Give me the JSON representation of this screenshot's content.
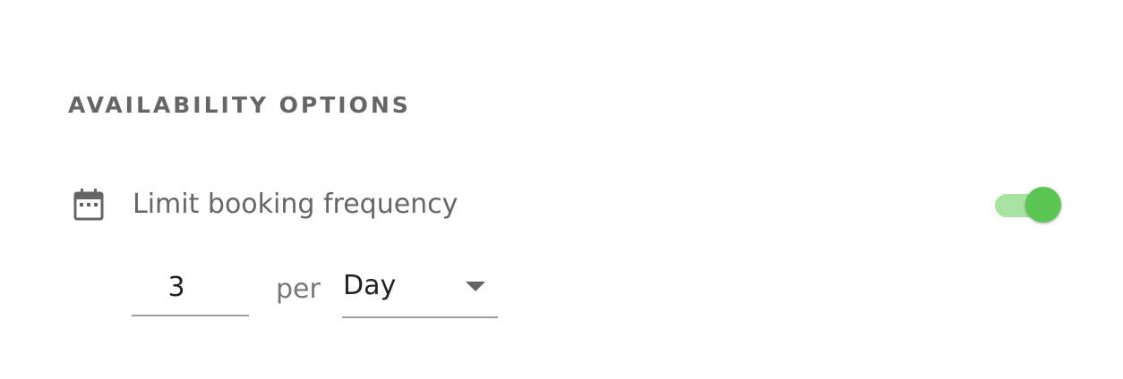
{
  "section": {
    "title": "AVAILABILITY OPTIONS"
  },
  "booking_frequency": {
    "icon": "calendar-icon",
    "label": "Limit booking frequency",
    "enabled": true,
    "count": "3",
    "per_label": "per",
    "unit": "Day"
  },
  "colors": {
    "toggle_on": "#5bc653",
    "toggle_track_on": "#a8e3a2",
    "text_muted": "#666666"
  }
}
